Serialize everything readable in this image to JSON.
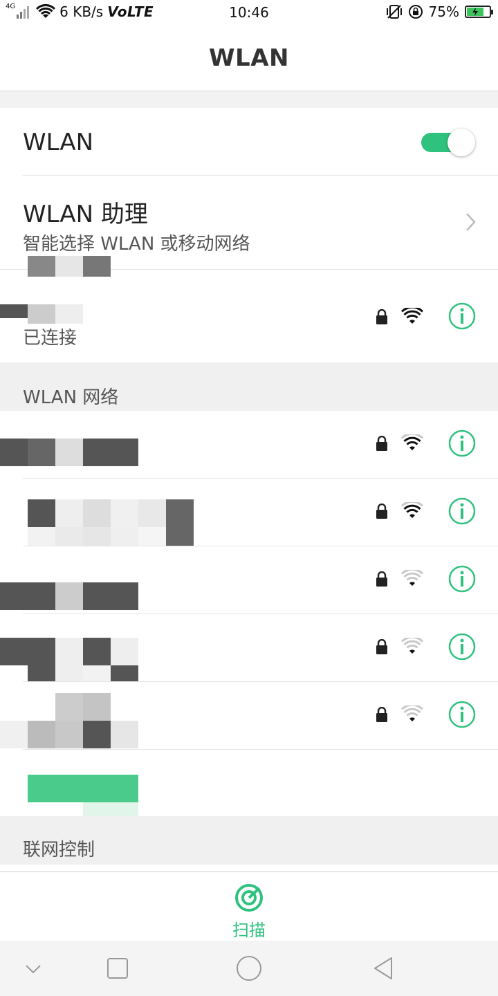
{
  "status_bar": {
    "network_type": "4G",
    "speed": "6 KB/s",
    "volte": "VoLTE",
    "time": "10:46",
    "battery_percent": "75%",
    "battery_level": 0.75
  },
  "header": {
    "title": "WLAN"
  },
  "wlan_toggle": {
    "label": "WLAN",
    "on": true
  },
  "assistant": {
    "title": "WLAN 助理",
    "subtitle": "智能选择 WLAN 或移动网络"
  },
  "connected": {
    "status": "已连接"
  },
  "networks_section": {
    "title": "WLAN 网络"
  },
  "networks": [
    {
      "secured": true,
      "signal": 3
    },
    {
      "secured": true,
      "signal": 3
    },
    {
      "secured": true,
      "signal": 1
    },
    {
      "secured": true,
      "signal": 1
    },
    {
      "secured": true,
      "signal": 1
    }
  ],
  "control_section": {
    "title": "联网控制"
  },
  "action_bar": {
    "scan_label": "扫描"
  },
  "colors": {
    "accent": "#2ec27e"
  }
}
